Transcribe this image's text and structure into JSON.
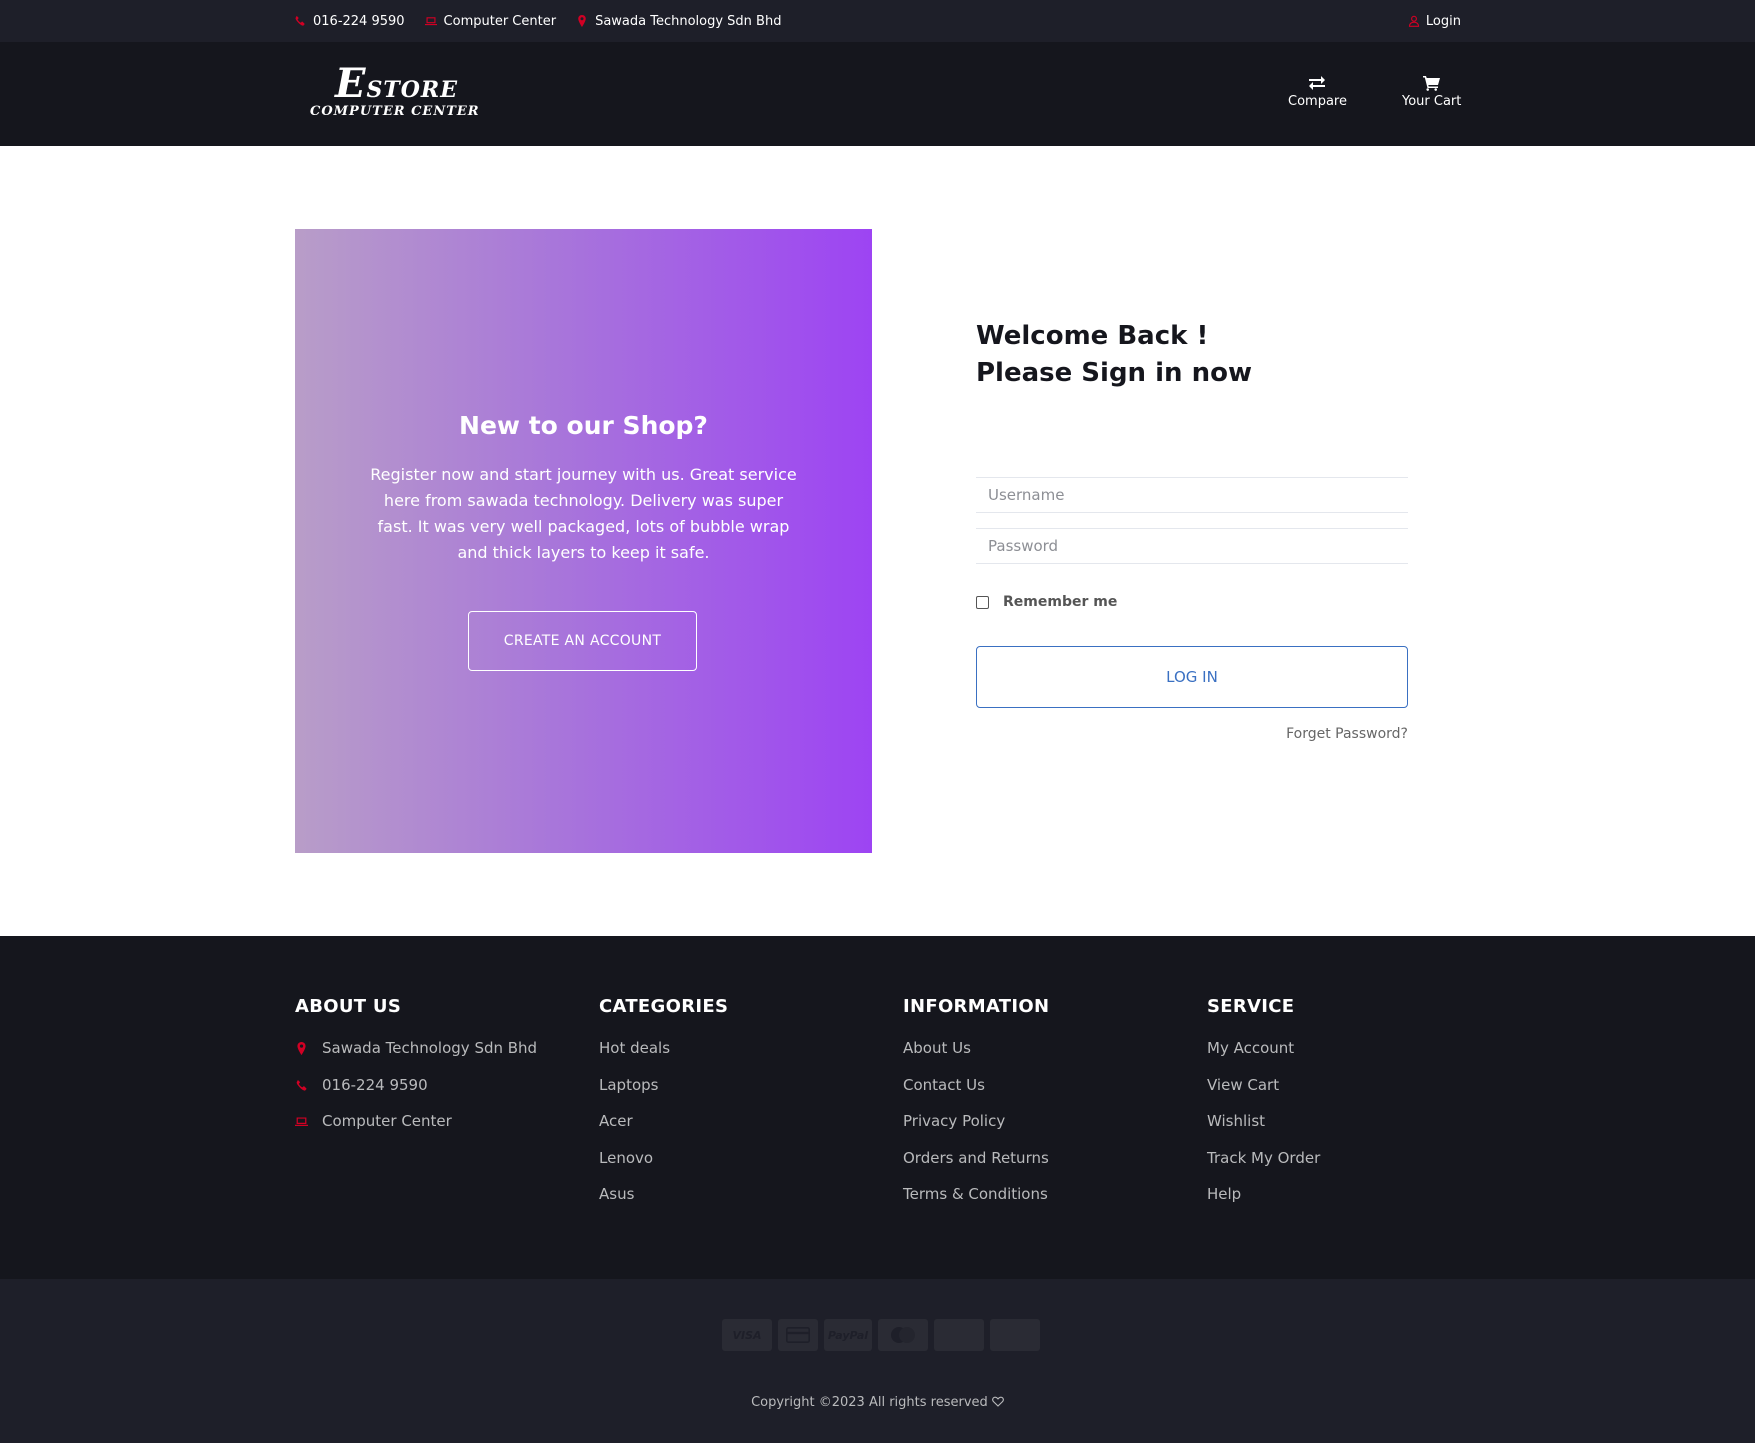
{
  "topbar": {
    "phone": "016-224 9590",
    "center": "Computer Center",
    "company": "Sawada Technology Sdn Bhd",
    "login": "Login"
  },
  "header": {
    "logo_line1_initial": "E",
    "logo_line1_rest": "STORE",
    "logo_line2": "COMPUTER CENTER",
    "compare": "Compare",
    "cart": "Your Cart"
  },
  "promo": {
    "title": "New to our Shop?",
    "text": "Register now and start journey with us. Great service here from sawada technology. Delivery was super fast. It was very well packaged, lots of bubble wrap and thick layers to keep it safe.",
    "button": "CREATE AN ACCOUNT"
  },
  "signin": {
    "title_line1": "Welcome Back !",
    "title_line2": "Please Sign in now",
    "username_placeholder": "Username",
    "password_placeholder": "Password",
    "remember": "Remember me",
    "login_button": "LOG IN",
    "forgot": "Forget Password?"
  },
  "footer": {
    "about": {
      "title": "ABOUT US",
      "items": [
        "Sawada Technology Sdn Bhd",
        "016-224 9590",
        "Computer Center"
      ]
    },
    "categories": {
      "title": "CATEGORIES",
      "items": [
        "Hot deals",
        "Laptops",
        "Acer",
        "Lenovo",
        "Asus"
      ]
    },
    "information": {
      "title": "INFORMATION",
      "items": [
        "About Us",
        "Contact Us",
        "Privacy Policy",
        "Orders and Returns",
        "Terms & Conditions"
      ]
    },
    "service": {
      "title": "SERVICE",
      "items": [
        "My Account",
        "View Cart",
        "Wishlist",
        "Track My Order",
        "Help"
      ]
    }
  },
  "bottom": {
    "cards": [
      "VISA",
      "",
      "PayPal",
      "",
      "",
      ""
    ],
    "copyright": "Copyright ©2023 All rights reserved"
  },
  "colors": {
    "accent": "#D10024",
    "dark": "#15161d",
    "topbar": "#1e1f29",
    "link_blue": "#3a70c2"
  },
  "icons": [
    "phone-icon",
    "laptop-icon",
    "map-marker-icon",
    "user-icon",
    "exchange-icon",
    "shopping-cart-icon",
    "heart-icon"
  ]
}
